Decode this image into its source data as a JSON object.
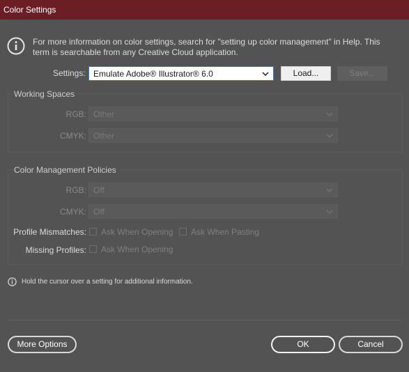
{
  "window": {
    "title": "Color Settings"
  },
  "info": {
    "text": "For more information on color settings, search for \"setting up color management\" in Help. This term is searchable from any Creative Cloud application."
  },
  "settings": {
    "label": "Settings:",
    "selected": "Emulate Adobe® Illustrator® 6.0",
    "load_label": "Load...",
    "save_label": "Save..."
  },
  "working_spaces": {
    "title": "Working Spaces",
    "rgb_label": "RGB:",
    "rgb_value": "Other",
    "cmyk_label": "CMYK:",
    "cmyk_value": "Other"
  },
  "policies": {
    "title": "Color Management Policies",
    "rgb_label": "RGB:",
    "rgb_value": "Off",
    "cmyk_label": "CMYK:",
    "cmyk_value": "Off",
    "mismatch_label": "Profile Mismatches:",
    "ask_opening": "Ask When Opening",
    "ask_pasting": "Ask When Pasting",
    "missing_label": "Missing Profiles:",
    "missing_ask_opening": "Ask When Opening"
  },
  "hint": "Hold the cursor over a setting for additional information.",
  "footer": {
    "more_options": "More Options",
    "ok": "OK",
    "cancel": "Cancel"
  },
  "colors": {
    "titlebar": "#6b1f24",
    "background": "#535353",
    "accent_border": "#2d7dd2"
  },
  "icons": [
    "info-icon",
    "chevron-down-icon"
  ]
}
